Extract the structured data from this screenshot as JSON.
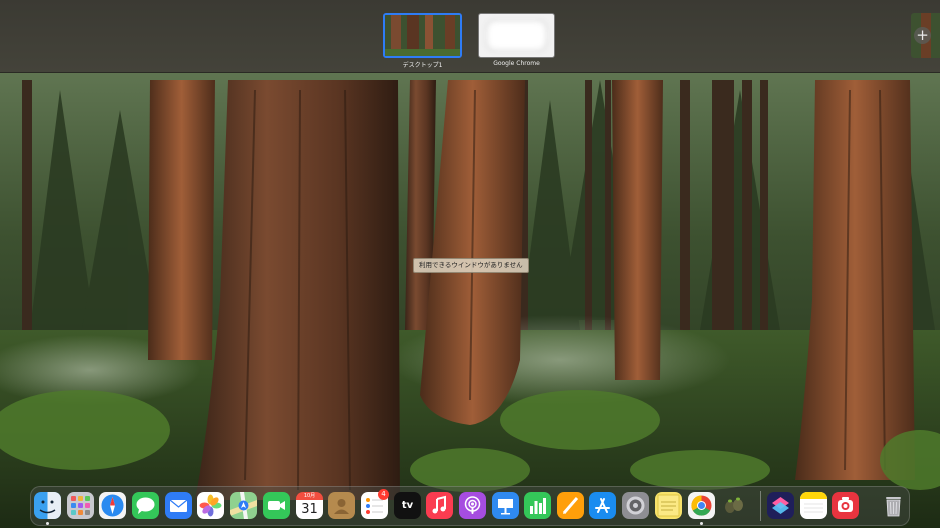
{
  "mission_control": {
    "spaces": [
      {
        "label": "デスクトップ1",
        "selected": true
      },
      {
        "label": "Google Chrome",
        "selected": false
      }
    ],
    "add_space_symbol": "+",
    "no_windows_message": "利用できるウインドウがありません"
  },
  "dock": {
    "items": [
      {
        "name": "Finder",
        "icon": "finder-icon",
        "running": true
      },
      {
        "name": "Launchpad",
        "icon": "launchpad-icon",
        "running": false
      },
      {
        "name": "Safari",
        "icon": "safari-icon",
        "running": false
      },
      {
        "name": "Messages",
        "icon": "messages-icon",
        "running": false
      },
      {
        "name": "Mail",
        "icon": "mail-icon",
        "running": false
      },
      {
        "name": "Photos",
        "icon": "photos-icon",
        "running": false
      },
      {
        "name": "Maps",
        "icon": "maps-icon",
        "running": false
      },
      {
        "name": "FaceTime",
        "icon": "facetime-icon",
        "running": false
      },
      {
        "name": "Calendar",
        "icon": "calendar-icon",
        "running": false,
        "month": "10月",
        "day": "31"
      },
      {
        "name": "Contacts",
        "icon": "contacts-icon",
        "running": false
      },
      {
        "name": "Reminders",
        "icon": "reminders-icon",
        "running": false,
        "badge": "4"
      },
      {
        "name": "TV",
        "icon": "tv-icon",
        "running": false,
        "label": "tv"
      },
      {
        "name": "Music",
        "icon": "music-icon",
        "running": false
      },
      {
        "name": "Podcasts",
        "icon": "podcasts-icon",
        "running": false
      },
      {
        "name": "Keynote",
        "icon": "keynote-icon",
        "running": false
      },
      {
        "name": "Numbers",
        "icon": "numbers-icon",
        "running": false
      },
      {
        "name": "Pages",
        "icon": "pages-icon",
        "running": false
      },
      {
        "name": "App Store",
        "icon": "app-store-icon",
        "running": false
      },
      {
        "name": "System Settings",
        "icon": "system-settings-icon",
        "running": false
      },
      {
        "name": "Stickies",
        "icon": "stickies-icon",
        "running": false
      },
      {
        "name": "Google Chrome",
        "icon": "chrome-icon",
        "running": true
      },
      {
        "name": "Script Editor",
        "icon": "script-editor-icon",
        "running": false
      },
      {
        "name": "Shortcuts",
        "icon": "shortcuts-icon",
        "running": false
      },
      {
        "name": "Notes",
        "icon": "notes-icon",
        "running": false
      },
      {
        "name": "Photo Booth",
        "icon": "photo-booth-icon",
        "running": false
      },
      {
        "name": "Trash",
        "icon": "trash-icon",
        "running": false
      }
    ]
  },
  "colors": {
    "selection_blue": "#2e7cf6",
    "badge_red": "#ff3b30"
  }
}
